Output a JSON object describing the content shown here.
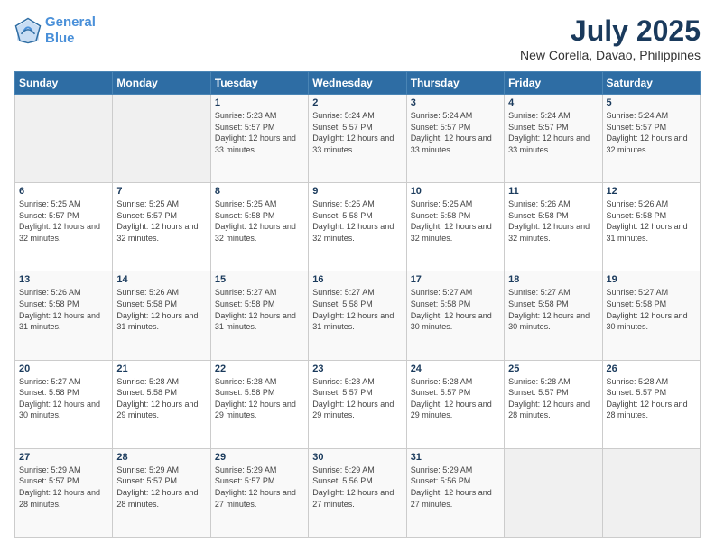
{
  "logo": {
    "line1": "General",
    "line2": "Blue"
  },
  "title": "July 2025",
  "subtitle": "New Corella, Davao, Philippines",
  "days_of_week": [
    "Sunday",
    "Monday",
    "Tuesday",
    "Wednesday",
    "Thursday",
    "Friday",
    "Saturday"
  ],
  "weeks": [
    [
      {
        "day": "",
        "sunrise": "",
        "sunset": "",
        "daylight": ""
      },
      {
        "day": "",
        "sunrise": "",
        "sunset": "",
        "daylight": ""
      },
      {
        "day": "1",
        "sunrise": "Sunrise: 5:23 AM",
        "sunset": "Sunset: 5:57 PM",
        "daylight": "Daylight: 12 hours and 33 minutes."
      },
      {
        "day": "2",
        "sunrise": "Sunrise: 5:24 AM",
        "sunset": "Sunset: 5:57 PM",
        "daylight": "Daylight: 12 hours and 33 minutes."
      },
      {
        "day": "3",
        "sunrise": "Sunrise: 5:24 AM",
        "sunset": "Sunset: 5:57 PM",
        "daylight": "Daylight: 12 hours and 33 minutes."
      },
      {
        "day": "4",
        "sunrise": "Sunrise: 5:24 AM",
        "sunset": "Sunset: 5:57 PM",
        "daylight": "Daylight: 12 hours and 33 minutes."
      },
      {
        "day": "5",
        "sunrise": "Sunrise: 5:24 AM",
        "sunset": "Sunset: 5:57 PM",
        "daylight": "Daylight: 12 hours and 32 minutes."
      }
    ],
    [
      {
        "day": "6",
        "sunrise": "Sunrise: 5:25 AM",
        "sunset": "Sunset: 5:57 PM",
        "daylight": "Daylight: 12 hours and 32 minutes."
      },
      {
        "day": "7",
        "sunrise": "Sunrise: 5:25 AM",
        "sunset": "Sunset: 5:57 PM",
        "daylight": "Daylight: 12 hours and 32 minutes."
      },
      {
        "day": "8",
        "sunrise": "Sunrise: 5:25 AM",
        "sunset": "Sunset: 5:58 PM",
        "daylight": "Daylight: 12 hours and 32 minutes."
      },
      {
        "day": "9",
        "sunrise": "Sunrise: 5:25 AM",
        "sunset": "Sunset: 5:58 PM",
        "daylight": "Daylight: 12 hours and 32 minutes."
      },
      {
        "day": "10",
        "sunrise": "Sunrise: 5:25 AM",
        "sunset": "Sunset: 5:58 PM",
        "daylight": "Daylight: 12 hours and 32 minutes."
      },
      {
        "day": "11",
        "sunrise": "Sunrise: 5:26 AM",
        "sunset": "Sunset: 5:58 PM",
        "daylight": "Daylight: 12 hours and 32 minutes."
      },
      {
        "day": "12",
        "sunrise": "Sunrise: 5:26 AM",
        "sunset": "Sunset: 5:58 PM",
        "daylight": "Daylight: 12 hours and 31 minutes."
      }
    ],
    [
      {
        "day": "13",
        "sunrise": "Sunrise: 5:26 AM",
        "sunset": "Sunset: 5:58 PM",
        "daylight": "Daylight: 12 hours and 31 minutes."
      },
      {
        "day": "14",
        "sunrise": "Sunrise: 5:26 AM",
        "sunset": "Sunset: 5:58 PM",
        "daylight": "Daylight: 12 hours and 31 minutes."
      },
      {
        "day": "15",
        "sunrise": "Sunrise: 5:27 AM",
        "sunset": "Sunset: 5:58 PM",
        "daylight": "Daylight: 12 hours and 31 minutes."
      },
      {
        "day": "16",
        "sunrise": "Sunrise: 5:27 AM",
        "sunset": "Sunset: 5:58 PM",
        "daylight": "Daylight: 12 hours and 31 minutes."
      },
      {
        "day": "17",
        "sunrise": "Sunrise: 5:27 AM",
        "sunset": "Sunset: 5:58 PM",
        "daylight": "Daylight: 12 hours and 30 minutes."
      },
      {
        "day": "18",
        "sunrise": "Sunrise: 5:27 AM",
        "sunset": "Sunset: 5:58 PM",
        "daylight": "Daylight: 12 hours and 30 minutes."
      },
      {
        "day": "19",
        "sunrise": "Sunrise: 5:27 AM",
        "sunset": "Sunset: 5:58 PM",
        "daylight": "Daylight: 12 hours and 30 minutes."
      }
    ],
    [
      {
        "day": "20",
        "sunrise": "Sunrise: 5:27 AM",
        "sunset": "Sunset: 5:58 PM",
        "daylight": "Daylight: 12 hours and 30 minutes."
      },
      {
        "day": "21",
        "sunrise": "Sunrise: 5:28 AM",
        "sunset": "Sunset: 5:58 PM",
        "daylight": "Daylight: 12 hours and 29 minutes."
      },
      {
        "day": "22",
        "sunrise": "Sunrise: 5:28 AM",
        "sunset": "Sunset: 5:58 PM",
        "daylight": "Daylight: 12 hours and 29 minutes."
      },
      {
        "day": "23",
        "sunrise": "Sunrise: 5:28 AM",
        "sunset": "Sunset: 5:57 PM",
        "daylight": "Daylight: 12 hours and 29 minutes."
      },
      {
        "day": "24",
        "sunrise": "Sunrise: 5:28 AM",
        "sunset": "Sunset: 5:57 PM",
        "daylight": "Daylight: 12 hours and 29 minutes."
      },
      {
        "day": "25",
        "sunrise": "Sunrise: 5:28 AM",
        "sunset": "Sunset: 5:57 PM",
        "daylight": "Daylight: 12 hours and 28 minutes."
      },
      {
        "day": "26",
        "sunrise": "Sunrise: 5:28 AM",
        "sunset": "Sunset: 5:57 PM",
        "daylight": "Daylight: 12 hours and 28 minutes."
      }
    ],
    [
      {
        "day": "27",
        "sunrise": "Sunrise: 5:29 AM",
        "sunset": "Sunset: 5:57 PM",
        "daylight": "Daylight: 12 hours and 28 minutes."
      },
      {
        "day": "28",
        "sunrise": "Sunrise: 5:29 AM",
        "sunset": "Sunset: 5:57 PM",
        "daylight": "Daylight: 12 hours and 28 minutes."
      },
      {
        "day": "29",
        "sunrise": "Sunrise: 5:29 AM",
        "sunset": "Sunset: 5:57 PM",
        "daylight": "Daylight: 12 hours and 27 minutes."
      },
      {
        "day": "30",
        "sunrise": "Sunrise: 5:29 AM",
        "sunset": "Sunset: 5:56 PM",
        "daylight": "Daylight: 12 hours and 27 minutes."
      },
      {
        "day": "31",
        "sunrise": "Sunrise: 5:29 AM",
        "sunset": "Sunset: 5:56 PM",
        "daylight": "Daylight: 12 hours and 27 minutes."
      },
      {
        "day": "",
        "sunrise": "",
        "sunset": "",
        "daylight": ""
      },
      {
        "day": "",
        "sunrise": "",
        "sunset": "",
        "daylight": ""
      }
    ]
  ]
}
